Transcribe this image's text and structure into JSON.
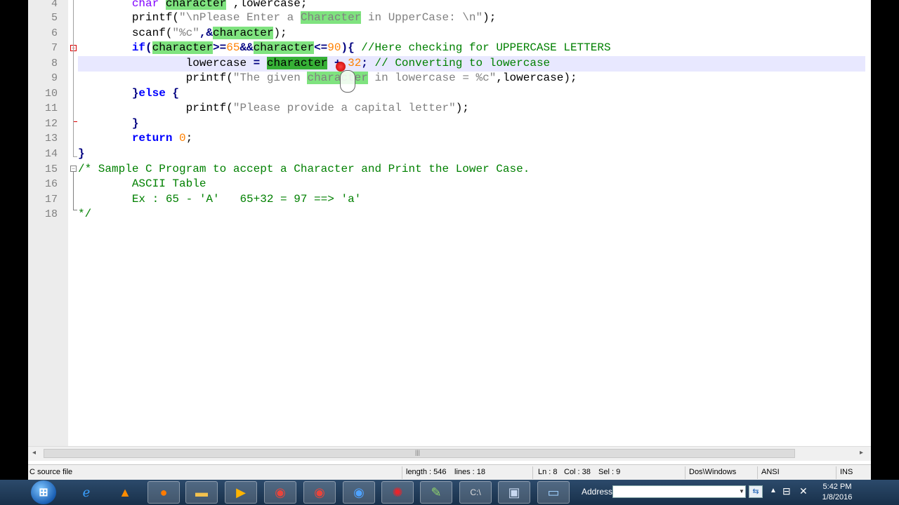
{
  "editor": {
    "lines": [
      {
        "num": "4"
      },
      {
        "num": "5"
      },
      {
        "num": "6"
      },
      {
        "num": "7"
      },
      {
        "num": "8"
      },
      {
        "num": "9"
      },
      {
        "num": "10"
      },
      {
        "num": "11"
      },
      {
        "num": "12"
      },
      {
        "num": "13"
      },
      {
        "num": "14"
      },
      {
        "num": "15"
      },
      {
        "num": "16"
      },
      {
        "num": "17"
      },
      {
        "num": "18"
      }
    ],
    "code": {
      "l4_type": "char",
      "l4_var": "character",
      "l4_rest": " ,lowercase;",
      "l5_fn": "printf(",
      "l5_str_a": "\"\\nPlease Enter a ",
      "l5_str_b": "Character",
      "l5_str_c": " in UpperCase: \\n\"",
      "l5_end": ");",
      "l6_fn": "scanf(",
      "l6_str": "\"%c\"",
      "l6_amp": ",&",
      "l6_var": "character",
      "l6_end": ");",
      "l7_kw": "if",
      "l7_p1": "(",
      "l7_var1": "character",
      "l7_op1": ">=",
      "l7_n1": "65",
      "l7_op2": "&&",
      "l7_var2": "character",
      "l7_op3": "<=",
      "l7_n2": "90",
      "l7_p2": "){",
      "l7_cm": " //Here checking for UPPERCASE LETTERS",
      "l8_a": "lowercase ",
      "l8_eq": "=",
      "l8_sp": " ",
      "l8_var": "character",
      "l8_plus": " + ",
      "l8_num": "32",
      "l8_semi": ";",
      "l8_cm": " // Converting to lowercase",
      "l9_fn": "printf(",
      "l9_str_a": "\"The given ",
      "l9_str_b": "character",
      "l9_str_c": " in lowercase = %c\"",
      "l9_end": ",lowercase);",
      "l10_a": "}",
      "l10_kw": "else",
      "l10_b": " {",
      "l11_fn": "printf(",
      "l11_str": "\"Please provide a capital letter\"",
      "l11_end": ");",
      "l12": "}",
      "l13_kw": "return",
      "l13_sp": " ",
      "l13_num": "0",
      "l13_end": ";",
      "l14": "}",
      "l15": "/* Sample C Program to accept a Character and Print the Lower Case.",
      "l16": "ASCII Table",
      "l17": "Ex : 65 - 'A'   65+32 = 97 ==> 'a'",
      "l18": "*/"
    }
  },
  "scrollbar": {
    "left_arrow": "◂",
    "right_arrow": "▸",
    "grip": "|||"
  },
  "status": {
    "file_type": "C source file",
    "length": "length : 546",
    "lines": "lines : 18",
    "ln": "Ln : 8",
    "col": "Col : 38",
    "sel": "Sel : 9",
    "eol": "Dos\\Windows",
    "encoding": "ANSI",
    "mode": "INS"
  },
  "taskbar": {
    "address_label": "Address",
    "address_value": "",
    "time": "5:42 PM",
    "date": "1/8/2016"
  },
  "colors": {
    "keyword": "#0000ff",
    "type": "#8000ff",
    "string": "#808080",
    "number": "#ff8000",
    "comment": "#008000",
    "smart_highlight": "#7fe37f",
    "current_line": "#e8e8ff",
    "fold_marker": "#d80000"
  },
  "icons": [
    "windows-start-icon",
    "internet-explorer-icon",
    "vlc-icon",
    "firefox-icon",
    "file-explorer-icon",
    "media-player-icon",
    "chrome-icon",
    "chrome-icon",
    "chrome-canary-icon",
    "airtel-icon",
    "notepad-plus-plus-icon",
    "cmd-icon",
    "save-icon",
    "image-viewer-icon"
  ]
}
